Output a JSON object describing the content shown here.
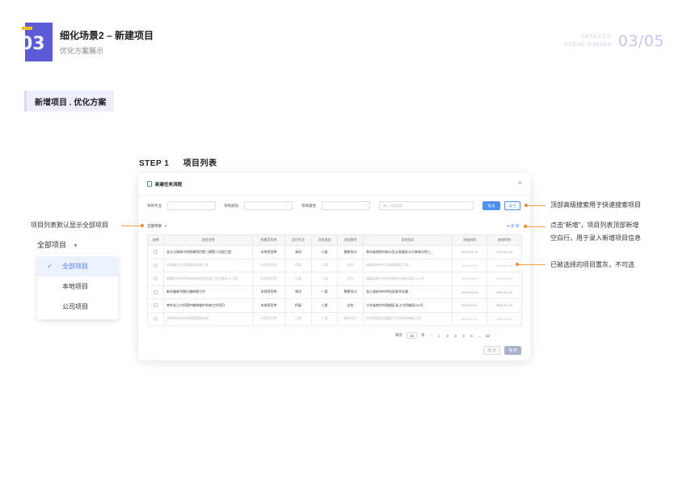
{
  "header": {
    "number": "03",
    "title": "细化场景2 – 新建项目",
    "subtitle": "优化方案展示",
    "tag_line1": "DETAILED",
    "tag_line2": "SCENE DSEIGN",
    "page": "03/05"
  },
  "section_tag": "新增项目 . 优化方案",
  "step": {
    "label": "STEP 1",
    "title": "项目列表"
  },
  "modal": {
    "title": "新建任务流程",
    "close": "×",
    "filters": {
      "label_major": "项目专业",
      "label_category": "项目类别",
      "label_attr": "项目属性",
      "search_placeholder": "输入内容搜索",
      "search_button": "搜 索",
      "clear_button": "清 空"
    },
    "scope_label": "全部项目",
    "add_new": "⊕ 新 增",
    "columns": [
      "选择",
      "项目名称",
      "所属项目库",
      "项目专业",
      "项目类别",
      "项目属性",
      "项目地点",
      "开始时间",
      "结束时间"
    ],
    "rows": [
      {
        "name": "金沙江跨海大桥修建项目第三期第六分段工程",
        "lib": "本地项目库",
        "major": "海洋",
        "cat": "二类",
        "attr": "勘察设计",
        "loc": "贵州省贵阳市新义区五和路金沙江跨海大桥三...",
        "start": "2016-04-20",
        "end": "2016-04-20",
        "disabled": false
      },
      {
        "name": "白鹤滩大大发展基础设施工程",
        "lib": "本地项目库",
        "major": "桥梁",
        "cat": "二类",
        "attr": "总包",
        "loc": "福建省泉州市石狮路建设二期",
        "start": "2016-03-01",
        "end": "2019-03-30",
        "disabled": true
      },
      {
        "name": "新翼学校市共和凯路农地凯泉施工项目基础于万物...",
        "lib": "本地项目库",
        "major": "公路",
        "cat": "一类",
        "attr": "总包",
        "loc": "福建省泉州市学府路安东路东侧区 200号",
        "start": "2016-04-01",
        "end": "2019-04-20",
        "disabled": true
      },
      {
        "name": "新光路新华路分路修建工作",
        "lib": "本地项目库",
        "major": "海洋",
        "cat": "一类",
        "attr": "勘察设计",
        "loc": "浙江省杭州市余杭区新华支路",
        "start": "2016-04-01",
        "end": "2020-01-19",
        "disabled": false
      },
      {
        "name": "南京长江大桥养护维修维护系统工作项目",
        "lib": "本地项目库",
        "major": "桥梁",
        "cat": "二类",
        "attr": "总包",
        "loc": "江苏省南京市鼓楼区长江大桥路段101号",
        "start": "2016-03-01",
        "end": "2020-02-20",
        "disabled": false
      },
      {
        "name": "伊利斯连接布高速路基础修复",
        "lib": "本地项目库",
        "major": "公路",
        "cat": "二类",
        "attr": "勘察设计",
        "loc": "伊拉斯路高速路面工作段结构修复方案",
        "start": "2016-03-15",
        "end": "2020-03-15",
        "disabled": true
      }
    ],
    "pager": {
      "per_label": "每页",
      "per_value": "10",
      "per_unit": "条",
      "prev": "‹",
      "pages": [
        "1",
        "2",
        "3",
        "4",
        "5",
        "...",
        "23"
      ],
      "current_page": "1",
      "next": "›"
    },
    "cancel": "取 消",
    "ok": "保 存"
  },
  "annotations": {
    "top_search": "顶部高级搜索用于快速搜索项目",
    "add_new_line1": "点击“新增”，项目列表顶部新增",
    "add_new_line2": "空白行，用于录入新增项目信息",
    "disabled_rows": "已被选择的项目置灰，不可选",
    "default_scope": "项目列表默认显示全部项目"
  },
  "dropdown": {
    "label": "全部项目",
    "items": [
      "全部项目",
      "本地项目",
      "公司项目"
    ],
    "selected": "全部项目"
  },
  "colors": {
    "accent_purple": "#5b5bd6",
    "accent_yellow": "#f4c21b",
    "primary_blue": "#4d8ff5",
    "annotation_orange": "#f08c28"
  }
}
